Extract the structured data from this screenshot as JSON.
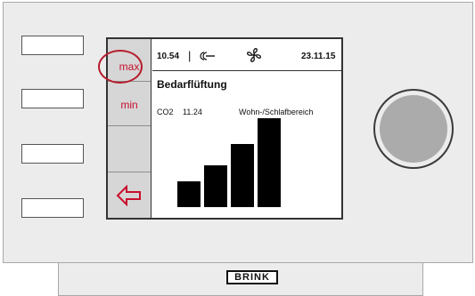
{
  "menu": {
    "max_label": "max",
    "min_label": "min",
    "back_icon": "back-arrow-icon"
  },
  "status": {
    "time": "10.54",
    "separator": "|",
    "mode_icon": "key-icon",
    "fan_icon": "fan-icon",
    "date": "23.11.15"
  },
  "screen": {
    "title": "Bedarflüftung",
    "sensor": "CO2",
    "sensor_value": "11.24",
    "zone": "Wohn-/Schlafbereich",
    "level_bars": [
      0.24,
      0.39,
      0.59,
      0.83
    ]
  },
  "device": {
    "brand": "BRINK"
  },
  "colors": {
    "accent": "#c8102e",
    "highlight": "#b61c2c"
  }
}
